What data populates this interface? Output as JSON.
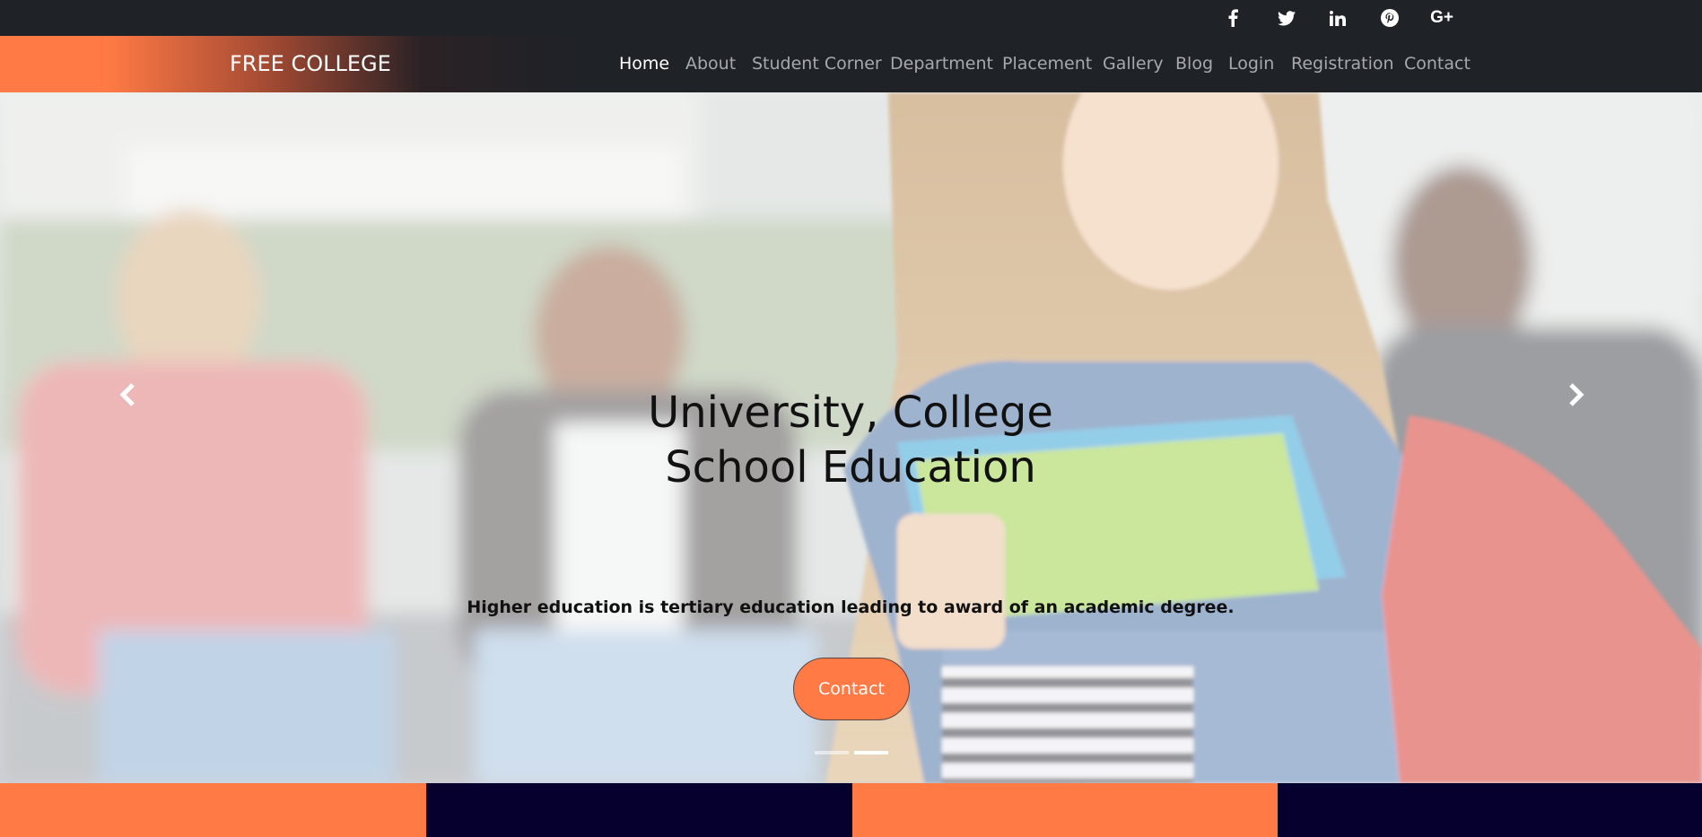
{
  "topbar": {
    "social": [
      {
        "icon": "facebook-icon"
      },
      {
        "icon": "twitter-icon"
      },
      {
        "icon": "linkedin-icon"
      },
      {
        "icon": "pinterest-icon"
      },
      {
        "icon": "google-plus-icon",
        "label": "G+"
      }
    ]
  },
  "navbar": {
    "brand": "FREE COLLEGE",
    "items": [
      {
        "label": "Home",
        "active": true
      },
      {
        "label": "About"
      },
      {
        "label": "Student Corner"
      },
      {
        "label": "Department"
      },
      {
        "label": "Placement"
      },
      {
        "label": "Gallery"
      },
      {
        "label": "Blog"
      },
      {
        "label": "Login"
      },
      {
        "label": "Registration"
      },
      {
        "label": "Contact"
      }
    ]
  },
  "hero": {
    "title_line1": "University, College",
    "title_line2": "School Education",
    "subtitle": "Higher education is tertiary education leading to award of an academic degree.",
    "button_label": "Contact",
    "prev_icon": "chevron-left-icon",
    "next_icon": "chevron-right-icon",
    "slides_count": 2,
    "active_slide": 2
  },
  "colors": {
    "accent": "#ff7a45",
    "dark": "#1f2227",
    "navy": "#06002e"
  }
}
